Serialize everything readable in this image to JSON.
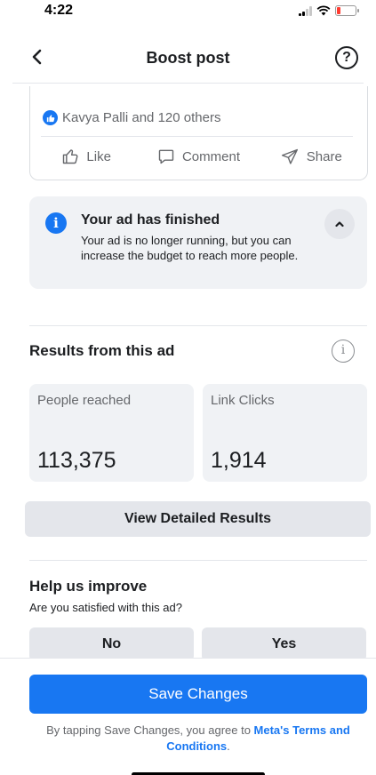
{
  "status_bar": {
    "time": "4:22"
  },
  "nav": {
    "title": "Boost post",
    "help_symbol": "?"
  },
  "post": {
    "reactions_text": "Kavya Palli and 120 others",
    "actions": [
      {
        "label": "Like",
        "icon": "thumbs-up-icon"
      },
      {
        "label": "Comment",
        "icon": "comment-icon"
      },
      {
        "label": "Share",
        "icon": "share-icon"
      }
    ]
  },
  "banner": {
    "title": "Your ad has finished",
    "body": "Your ad is no longer running, but you can increase the budget to reach more people.",
    "icon_symbol": "i"
  },
  "results": {
    "title": "Results from this ad",
    "info_symbol": "i",
    "metrics": [
      {
        "label": "People reached",
        "value": "113,375"
      },
      {
        "label": "Link Clicks",
        "value": "1,914"
      }
    ],
    "detail_button": "View Detailed Results"
  },
  "feedback": {
    "title": "Help us improve",
    "question": "Are you satisfied with this ad?",
    "options": [
      "No",
      "Yes"
    ]
  },
  "footer": {
    "save_label": "Save Changes",
    "terms_prefix": "By tapping Save Changes, you agree to ",
    "terms_link": "Meta's Terms and Conditions",
    "terms_suffix": "."
  },
  "colors": {
    "accent": "#1877f2",
    "surface": "#f0f2f5",
    "button_gray": "#e4e6eb",
    "battery_low": "#ff3b30"
  }
}
